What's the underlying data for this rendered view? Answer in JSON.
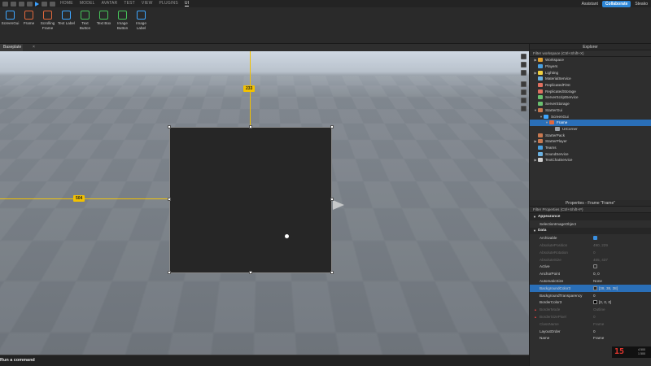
{
  "topbar": {
    "tabs": [
      "HOME",
      "MODEL",
      "AVATAR",
      "TEST",
      "VIEW",
      "PLUGINS",
      "UI"
    ],
    "assistant": "Assistant",
    "collaborate": "Collaborate",
    "user": "Steako"
  },
  "ribbon": [
    {
      "label": "ScreenGui",
      "color": "#3ea6ff"
    },
    {
      "label": "Frame",
      "color": "#e0683c"
    },
    {
      "label": "Scrolling Frame",
      "color": "#e0683c"
    },
    {
      "label": "Text Label",
      "color": "#3ea6ff"
    },
    {
      "label": "Text Button",
      "color": "#46c45a"
    },
    {
      "label": "Text Box",
      "color": "#46c45a"
    },
    {
      "label": "Image Button",
      "color": "#46c45a"
    },
    {
      "label": "Image Label",
      "color": "#3ea6ff"
    }
  ],
  "doc_tab": "Baseplate",
  "viewport": {
    "guide_v_label": "233",
    "guide_h_label": "504"
  },
  "command": "Run a command",
  "explorer": {
    "title": "Explorer",
    "filter": "Filter workspace (Ctrl+Shift+X)",
    "items": [
      {
        "label": "Workspace",
        "indent": 0,
        "arrow": "▶",
        "color": "#e0a030",
        "selected": false
      },
      {
        "label": "Players",
        "indent": 0,
        "arrow": "",
        "color": "#4aa0e0",
        "selected": false
      },
      {
        "label": "Lighting",
        "indent": 0,
        "arrow": "▶",
        "color": "#f0d040",
        "selected": false
      },
      {
        "label": "MaterialService",
        "indent": 0,
        "arrow": "",
        "color": "#6ab0e0",
        "selected": false
      },
      {
        "label": "ReplicatedFirst",
        "indent": 0,
        "arrow": "",
        "color": "#e07060",
        "selected": false
      },
      {
        "label": "ReplicatedStorage",
        "indent": 0,
        "arrow": "",
        "color": "#e07060",
        "selected": false
      },
      {
        "label": "ServerScriptService",
        "indent": 0,
        "arrow": "",
        "color": "#6ac070",
        "selected": false
      },
      {
        "label": "ServerStorage",
        "indent": 0,
        "arrow": "",
        "color": "#6ac070",
        "selected": false
      },
      {
        "label": "StarterGui",
        "indent": 0,
        "arrow": "▼",
        "color": "#c87850",
        "selected": false
      },
      {
        "label": "ScreenGui",
        "indent": 1,
        "arrow": "▼",
        "color": "#3ea6ff",
        "selected": false
      },
      {
        "label": "Frame",
        "indent": 2,
        "arrow": "▼",
        "color": "#e0683c",
        "selected": true
      },
      {
        "label": "UICorner",
        "indent": 3,
        "arrow": "",
        "color": "#9aa0a8",
        "selected": false
      },
      {
        "label": "StarterPack",
        "indent": 0,
        "arrow": "",
        "color": "#c87850",
        "selected": false
      },
      {
        "label": "StarterPlayer",
        "indent": 0,
        "arrow": "▶",
        "color": "#c87850",
        "selected": false
      },
      {
        "label": "Teams",
        "indent": 0,
        "arrow": "",
        "color": "#4aa0e0",
        "selected": false
      },
      {
        "label": "SoundService",
        "indent": 0,
        "arrow": "",
        "color": "#6ab0e0",
        "selected": false
      },
      {
        "label": "TextChatService",
        "indent": 0,
        "arrow": "▶",
        "color": "#d0d0d0",
        "selected": false
      }
    ]
  },
  "properties": {
    "title": "Properties - Frame \"Frame\"",
    "filter": "Filter Properties (Ctrl+Shift+P)",
    "sections": [
      {
        "type": "section",
        "label": "Appearance"
      },
      {
        "type": "prop",
        "name": "SelectionImageObject",
        "value": "",
        "kind": "text",
        "dim": false,
        "sel": false,
        "warn": false
      },
      {
        "type": "section",
        "label": "Data"
      },
      {
        "type": "prop",
        "name": "Archivable",
        "value": "",
        "kind": "check-on",
        "dim": false,
        "sel": false,
        "warn": false
      },
      {
        "type": "prop",
        "name": "AbsolutePosition",
        "value": "490, 229",
        "kind": "text",
        "dim": true,
        "sel": false,
        "warn": false
      },
      {
        "type": "prop",
        "name": "AbsoluteRotation",
        "value": "0",
        "kind": "text",
        "dim": true,
        "sel": false,
        "warn": false
      },
      {
        "type": "prop",
        "name": "AbsoluteSize",
        "value": "465, 437",
        "kind": "text",
        "dim": true,
        "sel": false,
        "warn": false
      },
      {
        "type": "prop",
        "name": "Active",
        "value": "",
        "kind": "check-off",
        "dim": false,
        "sel": false,
        "warn": false
      },
      {
        "type": "prop",
        "name": "AnchorPoint",
        "value": "0, 0",
        "kind": "text",
        "dim": false,
        "sel": false,
        "warn": false
      },
      {
        "type": "prop",
        "name": "AutomaticSize",
        "value": "None",
        "kind": "text",
        "dim": false,
        "sel": false,
        "warn": false
      },
      {
        "type": "prop",
        "name": "BackgroundColor3",
        "value": "[38, 38, 38]",
        "kind": "swatch",
        "swatch": "#262626",
        "dim": false,
        "sel": true,
        "warn": false
      },
      {
        "type": "prop",
        "name": "BackgroundTransparency",
        "value": "0",
        "kind": "text",
        "dim": false,
        "sel": false,
        "warn": false
      },
      {
        "type": "prop",
        "name": "BorderColor3",
        "value": "[0, 0, 0]",
        "kind": "swatch",
        "swatch": "#000000",
        "dim": false,
        "sel": false,
        "warn": false
      },
      {
        "type": "prop",
        "name": "BorderMode",
        "value": "Outline",
        "kind": "text",
        "dim": true,
        "sel": false,
        "warn": true
      },
      {
        "type": "prop",
        "name": "BorderSizePixel",
        "value": "0",
        "kind": "text",
        "dim": true,
        "sel": false,
        "warn": true
      },
      {
        "type": "prop",
        "name": "ClassName",
        "value": "Frame",
        "kind": "text",
        "dim": true,
        "sel": false,
        "warn": false
      },
      {
        "type": "prop",
        "name": "LayoutOrder",
        "value": "0",
        "kind": "text",
        "dim": false,
        "sel": false,
        "warn": false
      },
      {
        "type": "prop",
        "name": "Name",
        "value": "Frame",
        "kind": "text",
        "dim": false,
        "sel": false,
        "warn": false
      }
    ]
  },
  "corner": {
    "big": "15",
    "line1": "4 500",
    "line2": "1 500"
  }
}
